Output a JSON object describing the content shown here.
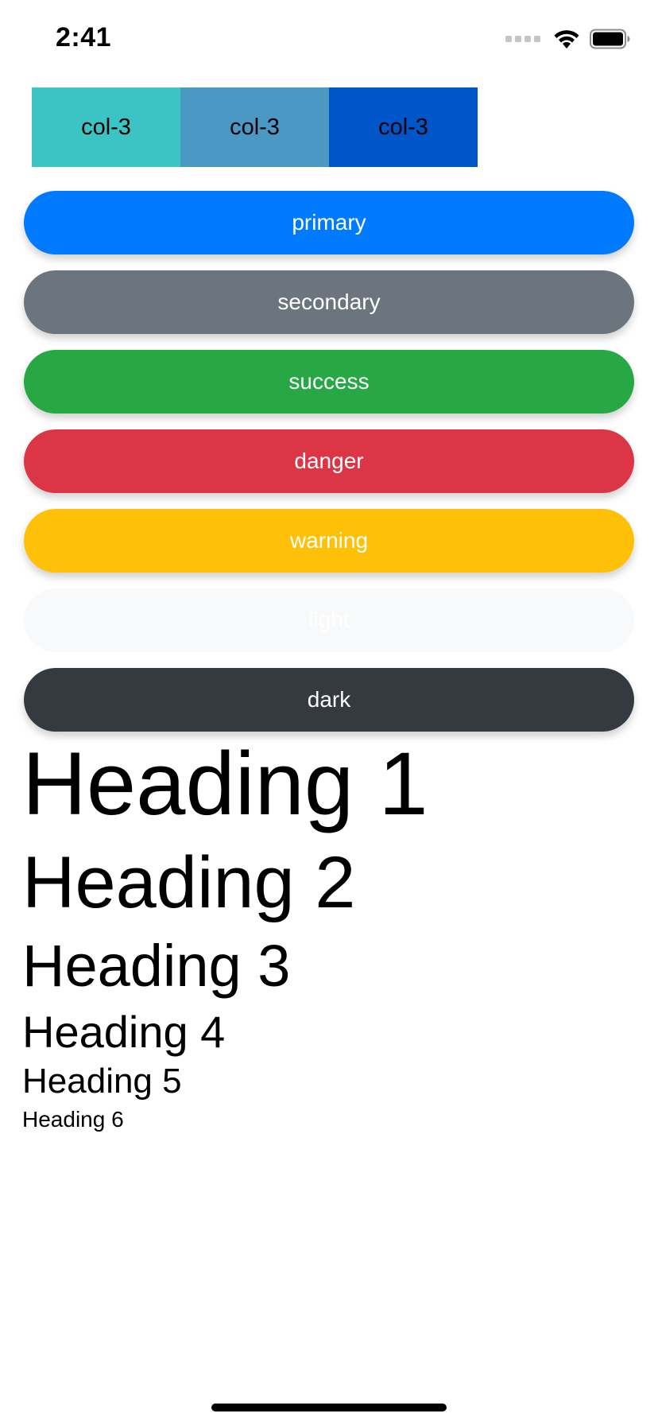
{
  "status_bar": {
    "time": "2:41"
  },
  "grid": {
    "columns": [
      {
        "label": "col-3",
        "color": "#3cc4c4"
      },
      {
        "label": "col-3",
        "color": "#4a98c4"
      },
      {
        "label": "col-3",
        "color": "#0055c8"
      }
    ]
  },
  "buttons": [
    {
      "label": "primary",
      "color": "#007bff",
      "text_color": "#ffffff"
    },
    {
      "label": "secondary",
      "color": "#6c757d",
      "text_color": "#ffffff"
    },
    {
      "label": "success",
      "color": "#28a745",
      "text_color": "#ffffff"
    },
    {
      "label": "danger",
      "color": "#dc3545",
      "text_color": "#ffffff"
    },
    {
      "label": "warning",
      "color": "#ffc107",
      "text_color": "#ffffff"
    },
    {
      "label": "light",
      "color": "#f8f9fa",
      "text_color": "#ffffff"
    },
    {
      "label": "dark",
      "color": "#343a40",
      "text_color": "#ffffff"
    }
  ],
  "headings": {
    "h1": "Heading 1",
    "h2": "Heading 2",
    "h3": "Heading 3",
    "h4": "Heading 4",
    "h5": "Heading 5",
    "h6": "Heading 6"
  },
  "icons": {
    "signal": "cellular-signal-icon",
    "wifi": "wifi-icon",
    "battery": "battery-icon"
  }
}
